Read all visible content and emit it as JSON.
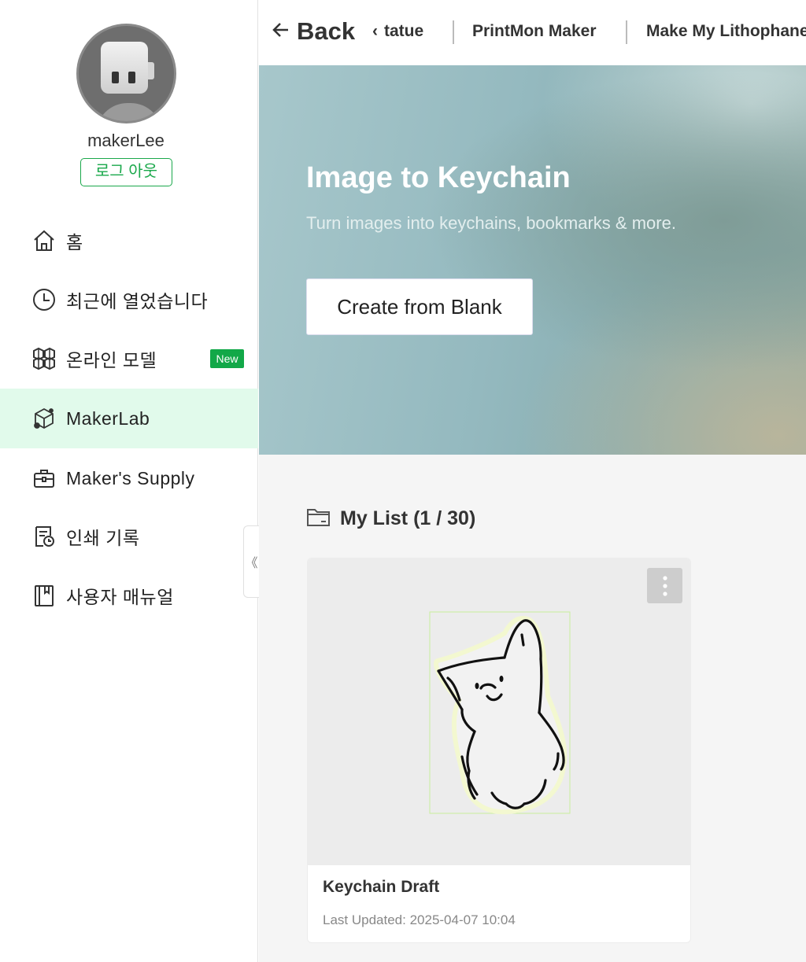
{
  "user": {
    "name": "makerLee",
    "logout_label": "로그 아웃"
  },
  "nav": {
    "items": [
      {
        "label": "홈",
        "icon": "home-icon"
      },
      {
        "label": "최근에 열었습니다",
        "icon": "clock-icon"
      },
      {
        "label": "온라인 모델",
        "icon": "cubes-icon",
        "badge": "New"
      },
      {
        "label": "MakerLab",
        "icon": "makerlab-icon",
        "active": true
      },
      {
        "label": "Maker's Supply",
        "icon": "toolbox-icon"
      },
      {
        "label": "인쇄 기록",
        "icon": "print-history-icon"
      },
      {
        "label": "사용자 매뉴얼",
        "icon": "manual-icon"
      }
    ],
    "collapse_glyph": "《"
  },
  "topbar": {
    "back_label": "Back",
    "crumbs": [
      "tatue",
      "PrintMon Maker",
      "Make My Lithophane"
    ]
  },
  "hero": {
    "title": "Image to Keychain",
    "subtitle": "Turn images into keychains, bookmarks & more.",
    "create_label": "Create from Blank"
  },
  "list": {
    "heading": "My List (1 / 30)",
    "cards": [
      {
        "title": "Keychain Draft",
        "updated": "Last Updated: 2025-04-07 10:04"
      }
    ]
  },
  "colors": {
    "accent": "#12a848",
    "active_bg": "#e1faeb",
    "logout": "#1aa84b"
  }
}
